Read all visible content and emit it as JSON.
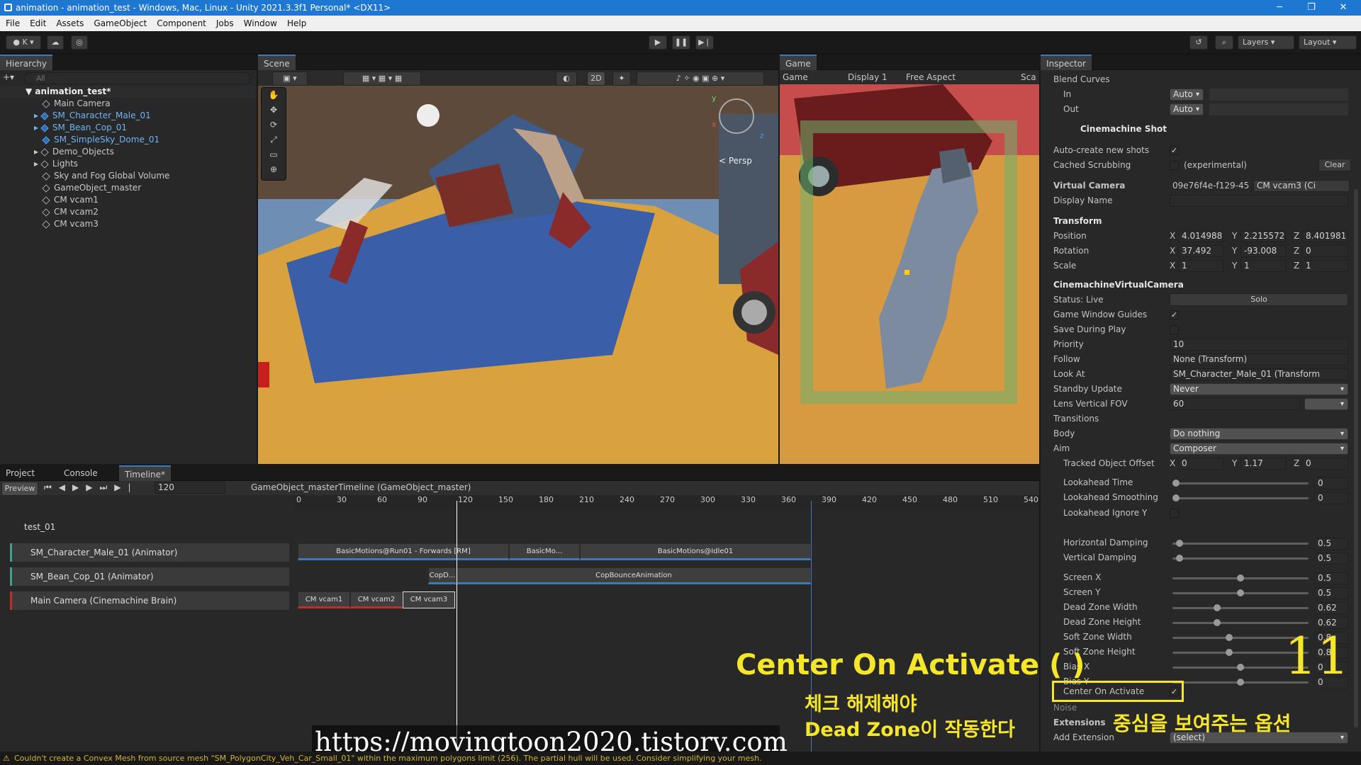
{
  "window": {
    "title": "animation - animation_test - Windows, Mac, Linux - Unity 2021.3.3f1 Personal* <DX11>",
    "minimize": "─",
    "maximize": "❐",
    "close": "✕"
  },
  "menu": [
    "File",
    "Edit",
    "Assets",
    "GameObject",
    "Component",
    "Jobs",
    "Window",
    "Help"
  ],
  "toolbar": {
    "account": "K ▾",
    "layers": "Layers",
    "layout": "Layout"
  },
  "hierarchy": {
    "tab": "Hierarchy",
    "search_placeholder": "All",
    "root": "animation_test*",
    "items": [
      "Main Camera",
      "SM_Character_Male_01",
      "SM_Bean_Cop_01",
      "SM_SimpleSky_Dome_01",
      "Demo_Objects",
      "Lights",
      "Sky and Fog Global Volume",
      "GameObject_master",
      "CM vcam1",
      "CM vcam2",
      "CM vcam3"
    ]
  },
  "scene": {
    "tab": "Scene",
    "btn_2d": "2D",
    "persp": "< Persp",
    "gizmo_y": "y",
    "gizmo_x": "x",
    "gizmo_z": "z"
  },
  "game": {
    "tab": "Game",
    "mode": "Game",
    "display": "Display 1",
    "aspect": "Free Aspect",
    "scale": "Sca"
  },
  "bottom": {
    "tab_project": "Project",
    "tab_console": "Console",
    "tab_timeline": "Timeline*",
    "preview": "Preview",
    "frame": "120",
    "asset": "GameObject_masterTimeline (GameObject_master)",
    "ruler": [
      "0",
      "30",
      "60",
      "90",
      "120",
      "150",
      "180",
      "210",
      "240",
      "270",
      "300",
      "330",
      "360",
      "390",
      "420",
      "450",
      "480",
      "510",
      "540"
    ],
    "group": "test_01",
    "tracks": [
      "SM_Character_Male_01 (Animator)",
      "SM_Bean_Cop_01 (Animator)",
      "Main Camera (Cinemachine Brain)"
    ],
    "clips": {
      "t1a": "BasicMotions@Run01 - Forwards [RM]",
      "t1b": "BasicMo...",
      "t1c": "BasicMotions@Idle01",
      "t2a": "CopD...",
      "t2b": "CopBounceAnimation",
      "t3a": "CM vcam1",
      "t3b": "CM vcam2",
      "t3c": "CM vcam3"
    }
  },
  "inspector": {
    "tab": "Inspector",
    "blend_curves": "Blend Curves",
    "in": "In",
    "out": "Out",
    "auto": "Auto",
    "shot_header": "Cinemachine Shot",
    "auto_create": "Auto-create new shots",
    "cached": "Cached Scrubbing",
    "experimental": "(experimental)",
    "clear": "Clear",
    "vcam_label": "Virtual Camera",
    "vcam_value": "09e76f4e-f129-45",
    "vcam_ref": "CM vcam3 (Ci",
    "display_name": "Display Name",
    "transform": "Transform",
    "position": "Position",
    "rotation": "Rotation",
    "scale": "Scale",
    "pos": [
      "4.014988",
      "2.215572",
      "8.401981"
    ],
    "rot": [
      "37.492",
      "-93.008",
      "0"
    ],
    "scl": [
      "1",
      "1",
      "1"
    ],
    "cvc": "CinemachineVirtualCamera",
    "status": "Status: Live",
    "solo": "Solo",
    "gwg": "Game Window Guides",
    "sdp": "Save During Play",
    "priority": "Priority",
    "priority_val": "10",
    "follow": "Follow",
    "follow_val": "None (Transform)",
    "lookat": "Look At",
    "lookat_val": "SM_Character_Male_01 (Transform",
    "standby": "Standby Update",
    "standby_val": "Never",
    "fov": "Lens Vertical FOV",
    "fov_val": "60",
    "transitions": "Transitions",
    "body": "Body",
    "body_val": "Do nothing",
    "aim": "Aim",
    "aim_val": "Composer",
    "tracked": "Tracked Object Offset",
    "tracked_vals": [
      "0",
      "1.17",
      "0"
    ],
    "sliders": [
      {
        "label": "Lookahead Time",
        "value": "0",
        "frac": 0
      },
      {
        "label": "Lookahead Smoothing",
        "value": "0",
        "frac": 0
      },
      {
        "label": "Horizontal Damping",
        "value": "0.5",
        "frac": 0.03
      },
      {
        "label": "Vertical Damping",
        "value": "0.5",
        "frac": 0.03
      },
      {
        "label": "Screen X",
        "value": "0.5",
        "frac": 0.5
      },
      {
        "label": "Screen Y",
        "value": "0.5",
        "frac": 0.5
      },
      {
        "label": "Dead Zone Width",
        "value": "0.62",
        "frac": 0.32
      },
      {
        "label": "Dead Zone Height",
        "value": "0.62",
        "frac": 0.32
      },
      {
        "label": "Soft Zone Width",
        "value": "0.8",
        "frac": 0.41
      },
      {
        "label": "Soft Zone Height",
        "value": "0.8",
        "frac": 0.41
      },
      {
        "label": "Bias X",
        "value": "0",
        "frac": 0.5
      },
      {
        "label": "Bias Y",
        "value": "0",
        "frac": 0.5
      }
    ],
    "ignore_y": "Lookahead Ignore Y",
    "center": "Center On Activate",
    "noise": "Noise",
    "extensions": "Extensions",
    "add_ext": "Add Extension",
    "select": "(select)"
  },
  "overlay": {
    "title": "Center On Activate (  )",
    "k1": "체크 해제해야",
    "k2": "Dead Zone이 작동한다",
    "k3": "중심을 보여주는 옵션",
    "num": "11",
    "url": "https://movingtoon2020.tistory.com"
  },
  "status": {
    "text": "Couldn't create a Convex Mesh from source mesh \"SM_PolygonCity_Veh_Car_Small_01\" within the maximum polygons limit (256). The partial hull will be used. Consider simplifying your mesh."
  },
  "colors": {
    "accent": "#3a79bb",
    "overlay_yellow": "#f5e62a"
  }
}
